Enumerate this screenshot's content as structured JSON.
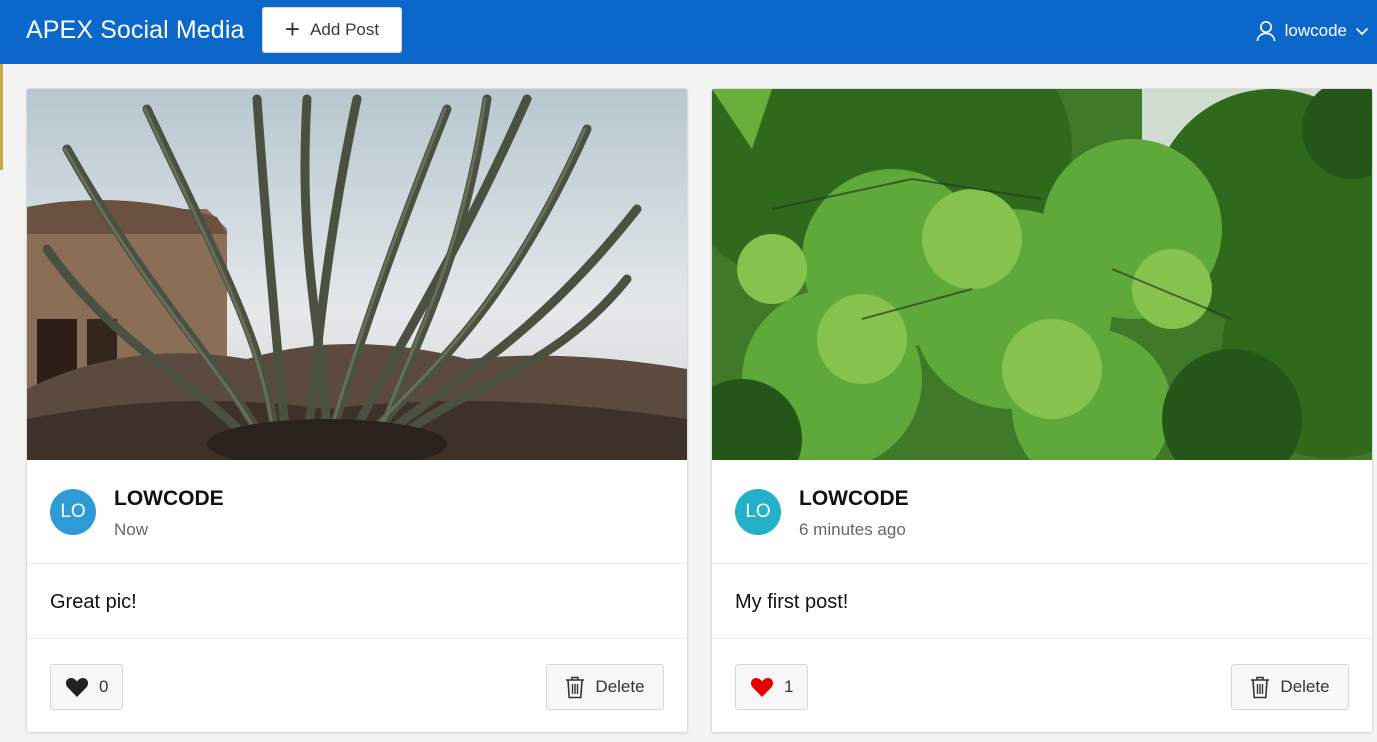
{
  "header": {
    "app_title": "APEX Social Media",
    "add_post_label": "Add Post",
    "user_name": "lowcode",
    "background_color": "#0b67c9"
  },
  "posts": [
    {
      "image_description_icon": "photo",
      "avatar_initials": "LO",
      "avatar_color": "#2e9bd6",
      "author": "LOWCODE",
      "time": "Now",
      "text": "Great pic!",
      "like_count": "0",
      "liked": false,
      "delete_label": "Delete"
    },
    {
      "image_description_icon": "photo",
      "avatar_initials": "LO",
      "avatar_color": "#23b0c8",
      "author": "LOWCODE",
      "time": "6 minutes ago",
      "text": "My first post!",
      "like_count": "1",
      "liked": true,
      "delete_label": "Delete"
    }
  ],
  "colors": {
    "heart_unliked": "#222222",
    "heart_liked": "#e60000"
  }
}
